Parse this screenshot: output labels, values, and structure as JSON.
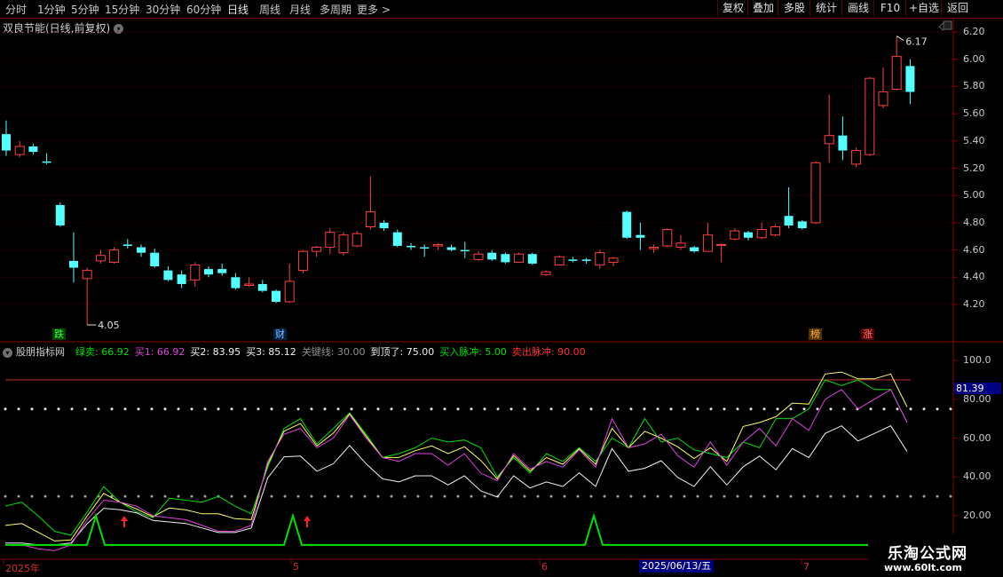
{
  "toolbar": {
    "periods": [
      "分时",
      "1分钟",
      "5分钟",
      "15分钟",
      "30分钟",
      "60分钟",
      "日线",
      "周线",
      "月线",
      "多周期",
      "更多 >"
    ],
    "active_period": "日线",
    "right_buttons": [
      "复权",
      "叠加",
      "多股",
      "统计",
      "画线",
      "F10",
      "+自选",
      "返回"
    ]
  },
  "chart_title": "双良节能(日线,前复权)",
  "price_axis": [
    "6.20",
    "6.00",
    "5.80",
    "5.60",
    "5.40",
    "5.20",
    "5.00",
    "4.80",
    "4.60",
    "4.40",
    "4.20"
  ],
  "high_label": "6.17",
  "low_label": "4.05",
  "markers": {
    "die": "跌",
    "cai": "财",
    "bang": "榜",
    "zhang": "涨"
  },
  "indicator": {
    "name": "股朋指标网",
    "items": [
      {
        "label": "绿卖: 66.92",
        "color": "#00e000"
      },
      {
        "label": "买1: 66.92",
        "color": "#e040e0"
      },
      {
        "label": "买2: 83.95",
        "color": "#f0f0f0"
      },
      {
        "label": "买3: 85.12",
        "color": "#f0f0f0"
      },
      {
        "label": "关键线: 30.00",
        "color": "#909090"
      },
      {
        "label": "到顶了: 75.00",
        "color": "#f0f0f0"
      },
      {
        "label": "买入脉冲: 5.00",
        "color": "#00e000"
      },
      {
        "label": "卖出脉冲: 90.00",
        "color": "#ff3030"
      }
    ],
    "axis": [
      "100.0",
      "80.00",
      "60.00",
      "40.00",
      "20.00"
    ],
    "current_value": "81.39"
  },
  "date_axis": {
    "labels": [
      "2025年",
      "5",
      "6",
      "7"
    ],
    "cursor_date": "2025/06/13/五"
  },
  "watermark": {
    "title": "乐淘公式网",
    "url": "www.60lt.com"
  },
  "colors": {
    "up": "#ff4040",
    "down": "#54ffff",
    "grid": "#8a0000",
    "yellow": "#ffff60",
    "magenta": "#e040e0",
    "green": "#00e000",
    "white": "#f0f0f0"
  },
  "chart_data": {
    "type": "candlestick",
    "candles": [
      [
        5.45,
        5.33,
        5.55,
        5.29
      ],
      [
        5.3,
        5.36,
        5.4,
        5.28
      ],
      [
        5.36,
        5.32,
        5.38,
        5.3
      ],
      [
        5.25,
        5.24,
        5.31,
        5.23
      ],
      [
        4.93,
        4.78,
        4.95,
        4.77
      ],
      [
        4.52,
        4.47,
        4.73,
        4.36
      ],
      [
        4.39,
        4.45,
        4.47,
        4.05
      ],
      [
        4.52,
        4.56,
        4.6,
        4.5
      ],
      [
        4.51,
        4.6,
        4.62,
        4.5
      ],
      [
        4.64,
        4.63,
        4.68,
        4.61
      ],
      [
        4.62,
        4.58,
        4.64,
        4.55
      ],
      [
        4.58,
        4.48,
        4.61,
        4.47
      ],
      [
        4.45,
        4.38,
        4.48,
        4.37
      ],
      [
        4.42,
        4.35,
        4.45,
        4.32
      ],
      [
        4.38,
        4.49,
        4.51,
        4.33
      ],
      [
        4.46,
        4.42,
        4.48,
        4.4
      ],
      [
        4.46,
        4.43,
        4.5,
        4.41
      ],
      [
        4.4,
        4.32,
        4.43,
        4.31
      ],
      [
        4.34,
        4.35,
        4.4,
        4.33
      ],
      [
        4.35,
        4.3,
        4.38,
        4.29
      ],
      [
        4.3,
        4.22,
        4.31,
        4.21
      ],
      [
        4.22,
        4.37,
        4.5,
        4.21
      ],
      [
        4.45,
        4.59,
        4.6,
        4.43
      ],
      [
        4.59,
        4.62,
        4.63,
        4.55
      ],
      [
        4.62,
        4.73,
        4.76,
        4.57
      ],
      [
        4.58,
        4.71,
        4.73,
        4.56
      ],
      [
        4.63,
        4.72,
        4.74,
        4.62
      ],
      [
        4.77,
        4.88,
        5.14,
        4.75
      ],
      [
        4.8,
        4.76,
        4.82,
        4.74
      ],
      [
        4.73,
        4.63,
        4.75,
        4.62
      ],
      [
        4.63,
        4.62,
        4.65,
        4.6
      ],
      [
        4.62,
        4.61,
        4.64,
        4.55
      ],
      [
        4.63,
        4.64,
        4.65,
        4.6
      ],
      [
        4.62,
        4.6,
        4.64,
        4.59
      ],
      [
        4.6,
        4.59,
        4.66,
        4.54
      ],
      [
        4.53,
        4.57,
        4.59,
        4.52
      ],
      [
        4.58,
        4.53,
        4.6,
        4.52
      ],
      [
        4.57,
        4.51,
        4.58,
        4.5
      ],
      [
        4.51,
        4.57,
        4.58,
        4.51
      ],
      [
        4.57,
        4.5,
        4.58,
        4.49
      ],
      [
        4.42,
        4.44,
        4.45,
        4.41
      ],
      [
        4.49,
        4.55,
        4.56,
        4.49
      ],
      [
        4.53,
        4.52,
        4.55,
        4.51
      ],
      [
        4.53,
        4.52,
        4.54,
        4.5
      ],
      [
        4.49,
        4.58,
        4.6,
        4.46
      ],
      [
        4.51,
        4.54,
        4.55,
        4.48
      ],
      [
        4.88,
        4.69,
        4.89,
        4.68
      ],
      [
        4.71,
        4.69,
        4.8,
        4.6
      ],
      [
        4.61,
        4.62,
        4.64,
        4.58
      ],
      [
        4.63,
        4.75,
        4.76,
        4.62
      ],
      [
        4.62,
        4.65,
        4.71,
        4.6
      ],
      [
        4.62,
        4.59,
        4.63,
        4.58
      ],
      [
        4.59,
        4.71,
        4.8,
        4.59
      ],
      [
        4.64,
        4.64,
        4.65,
        4.51
      ],
      [
        4.68,
        4.74,
        4.76,
        4.67
      ],
      [
        4.73,
        4.69,
        4.74,
        4.67
      ],
      [
        4.69,
        4.75,
        4.8,
        4.68
      ],
      [
        4.71,
        4.77,
        4.79,
        4.7
      ],
      [
        4.85,
        4.78,
        5.06,
        4.76
      ],
      [
        4.81,
        4.76,
        4.82,
        4.75
      ],
      [
        4.8,
        5.24,
        5.25,
        4.79
      ],
      [
        5.38,
        5.44,
        5.74,
        5.24
      ],
      [
        5.44,
        5.33,
        5.58,
        5.26
      ],
      [
        5.23,
        5.33,
        5.35,
        5.21
      ],
      [
        5.3,
        5.86,
        5.87,
        5.29
      ],
      [
        5.66,
        5.76,
        5.94,
        5.64
      ],
      [
        5.78,
        6.02,
        6.17,
        5.77
      ],
      [
        5.95,
        5.76,
        6.0,
        5.67
      ]
    ],
    "indicator_series": [
      {
        "name": "绿卖",
        "values": [
          25,
          27,
          20,
          12,
          10,
          22,
          35,
          27,
          22,
          19,
          29,
          28,
          27,
          30,
          25,
          21,
          45,
          65,
          70,
          57,
          65,
          73,
          62,
          50,
          52,
          55,
          60,
          58,
          59,
          55,
          40,
          50,
          42,
          52,
          48,
          55,
          48,
          60,
          55,
          70,
          58,
          60,
          54,
          52,
          50,
          58,
          55,
          70,
          70,
          75,
          90,
          87,
          90,
          85,
          85,
          68
        ]
      },
      {
        "name": "买1",
        "values": [
          5,
          5,
          3,
          2,
          5,
          18,
          28,
          27,
          25,
          20,
          19,
          18,
          15,
          12,
          12,
          15,
          48,
          62,
          65,
          55,
          60,
          72,
          60,
          50,
          48,
          52,
          52,
          46,
          52,
          42,
          38,
          52,
          44,
          48,
          45,
          54,
          45,
          70,
          55,
          57,
          62,
          51,
          45,
          58,
          46,
          58,
          65,
          56,
          70,
          64,
          80,
          85,
          75,
          80,
          85,
          68
        ]
      }
    ]
  }
}
